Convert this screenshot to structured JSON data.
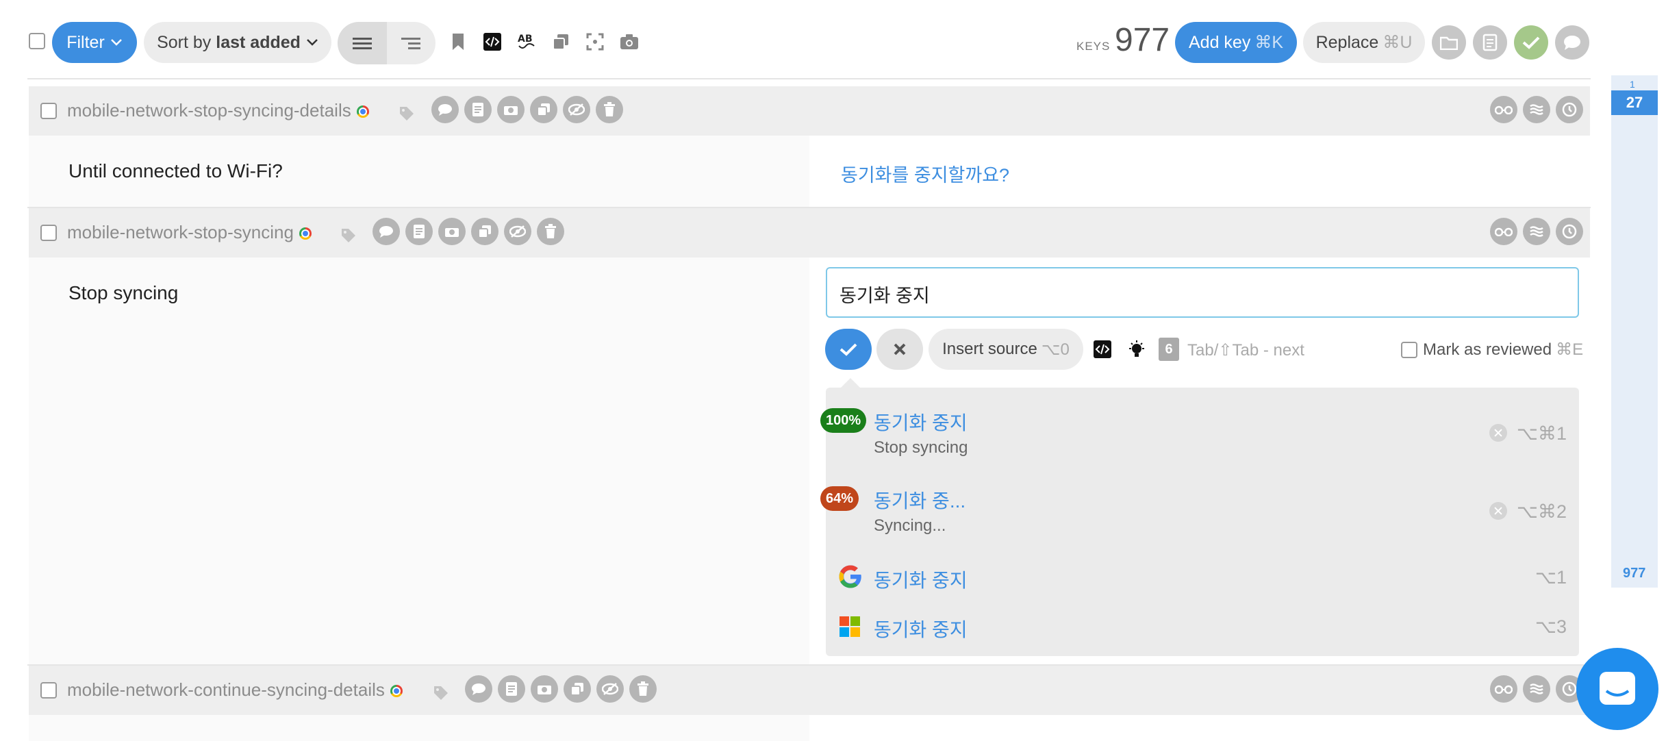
{
  "toolbar": {
    "filter_label": "Filter",
    "sort_prefix": "Sort by",
    "sort_value": "last added",
    "keys_label": "KEYS",
    "keys_count": "977",
    "add_key_label": "Add key",
    "add_key_shortcut": "⌘K",
    "replace_label": "Replace",
    "replace_shortcut": "⌘U",
    "icons": [
      "bookmark-icon",
      "code-tag-icon",
      "spellcheck-icon",
      "copy-icon",
      "screenshot-frame-icon",
      "camera-icon"
    ],
    "right_icons": [
      "folder-icon",
      "document-icon",
      "check-icon",
      "chat-icon"
    ]
  },
  "keys": [
    {
      "name": "mobile-network-stop-syncing-details",
      "source": "Until connected to Wi-Fi?",
      "translation": "동기화를 중지할까요?"
    },
    {
      "name": "mobile-network-stop-syncing",
      "source": "Stop syncing",
      "translation": "동기화 중지"
    },
    {
      "name": "mobile-network-continue-syncing-details"
    }
  ],
  "editor": {
    "value": "동기화 중지",
    "insert_source_label": "Insert source",
    "insert_source_shortcut": "⌥0",
    "counter": "6",
    "hint": "Tab/⇧Tab - next",
    "mark_reviewed_label": "Mark as reviewed",
    "mark_reviewed_shortcut": "⌘E"
  },
  "suggestions": [
    {
      "badge": "100%",
      "badge_color": "#1a7f1a",
      "text": "동기화 중지",
      "source": "Stop syncing",
      "shortcut": "⌥⌘1"
    },
    {
      "badge": "64%",
      "badge_color": "#c0461b",
      "text": "동기화 중...",
      "source": "Syncing...",
      "shortcut": "⌥⌘2"
    },
    {
      "provider": "google-icon",
      "text": "동기화 중지",
      "shortcut": "⌥1"
    },
    {
      "provider": "microsoft-icon",
      "text": "동기화 중지",
      "shortcut": "⌥3"
    }
  ],
  "scrollbar": {
    "top_label": "1",
    "current": "27",
    "bottom_label": "977"
  },
  "colors": {
    "accent": "#3d8ee0",
    "success": "#a5c88a",
    "focus_border": "#7fc8e8"
  }
}
